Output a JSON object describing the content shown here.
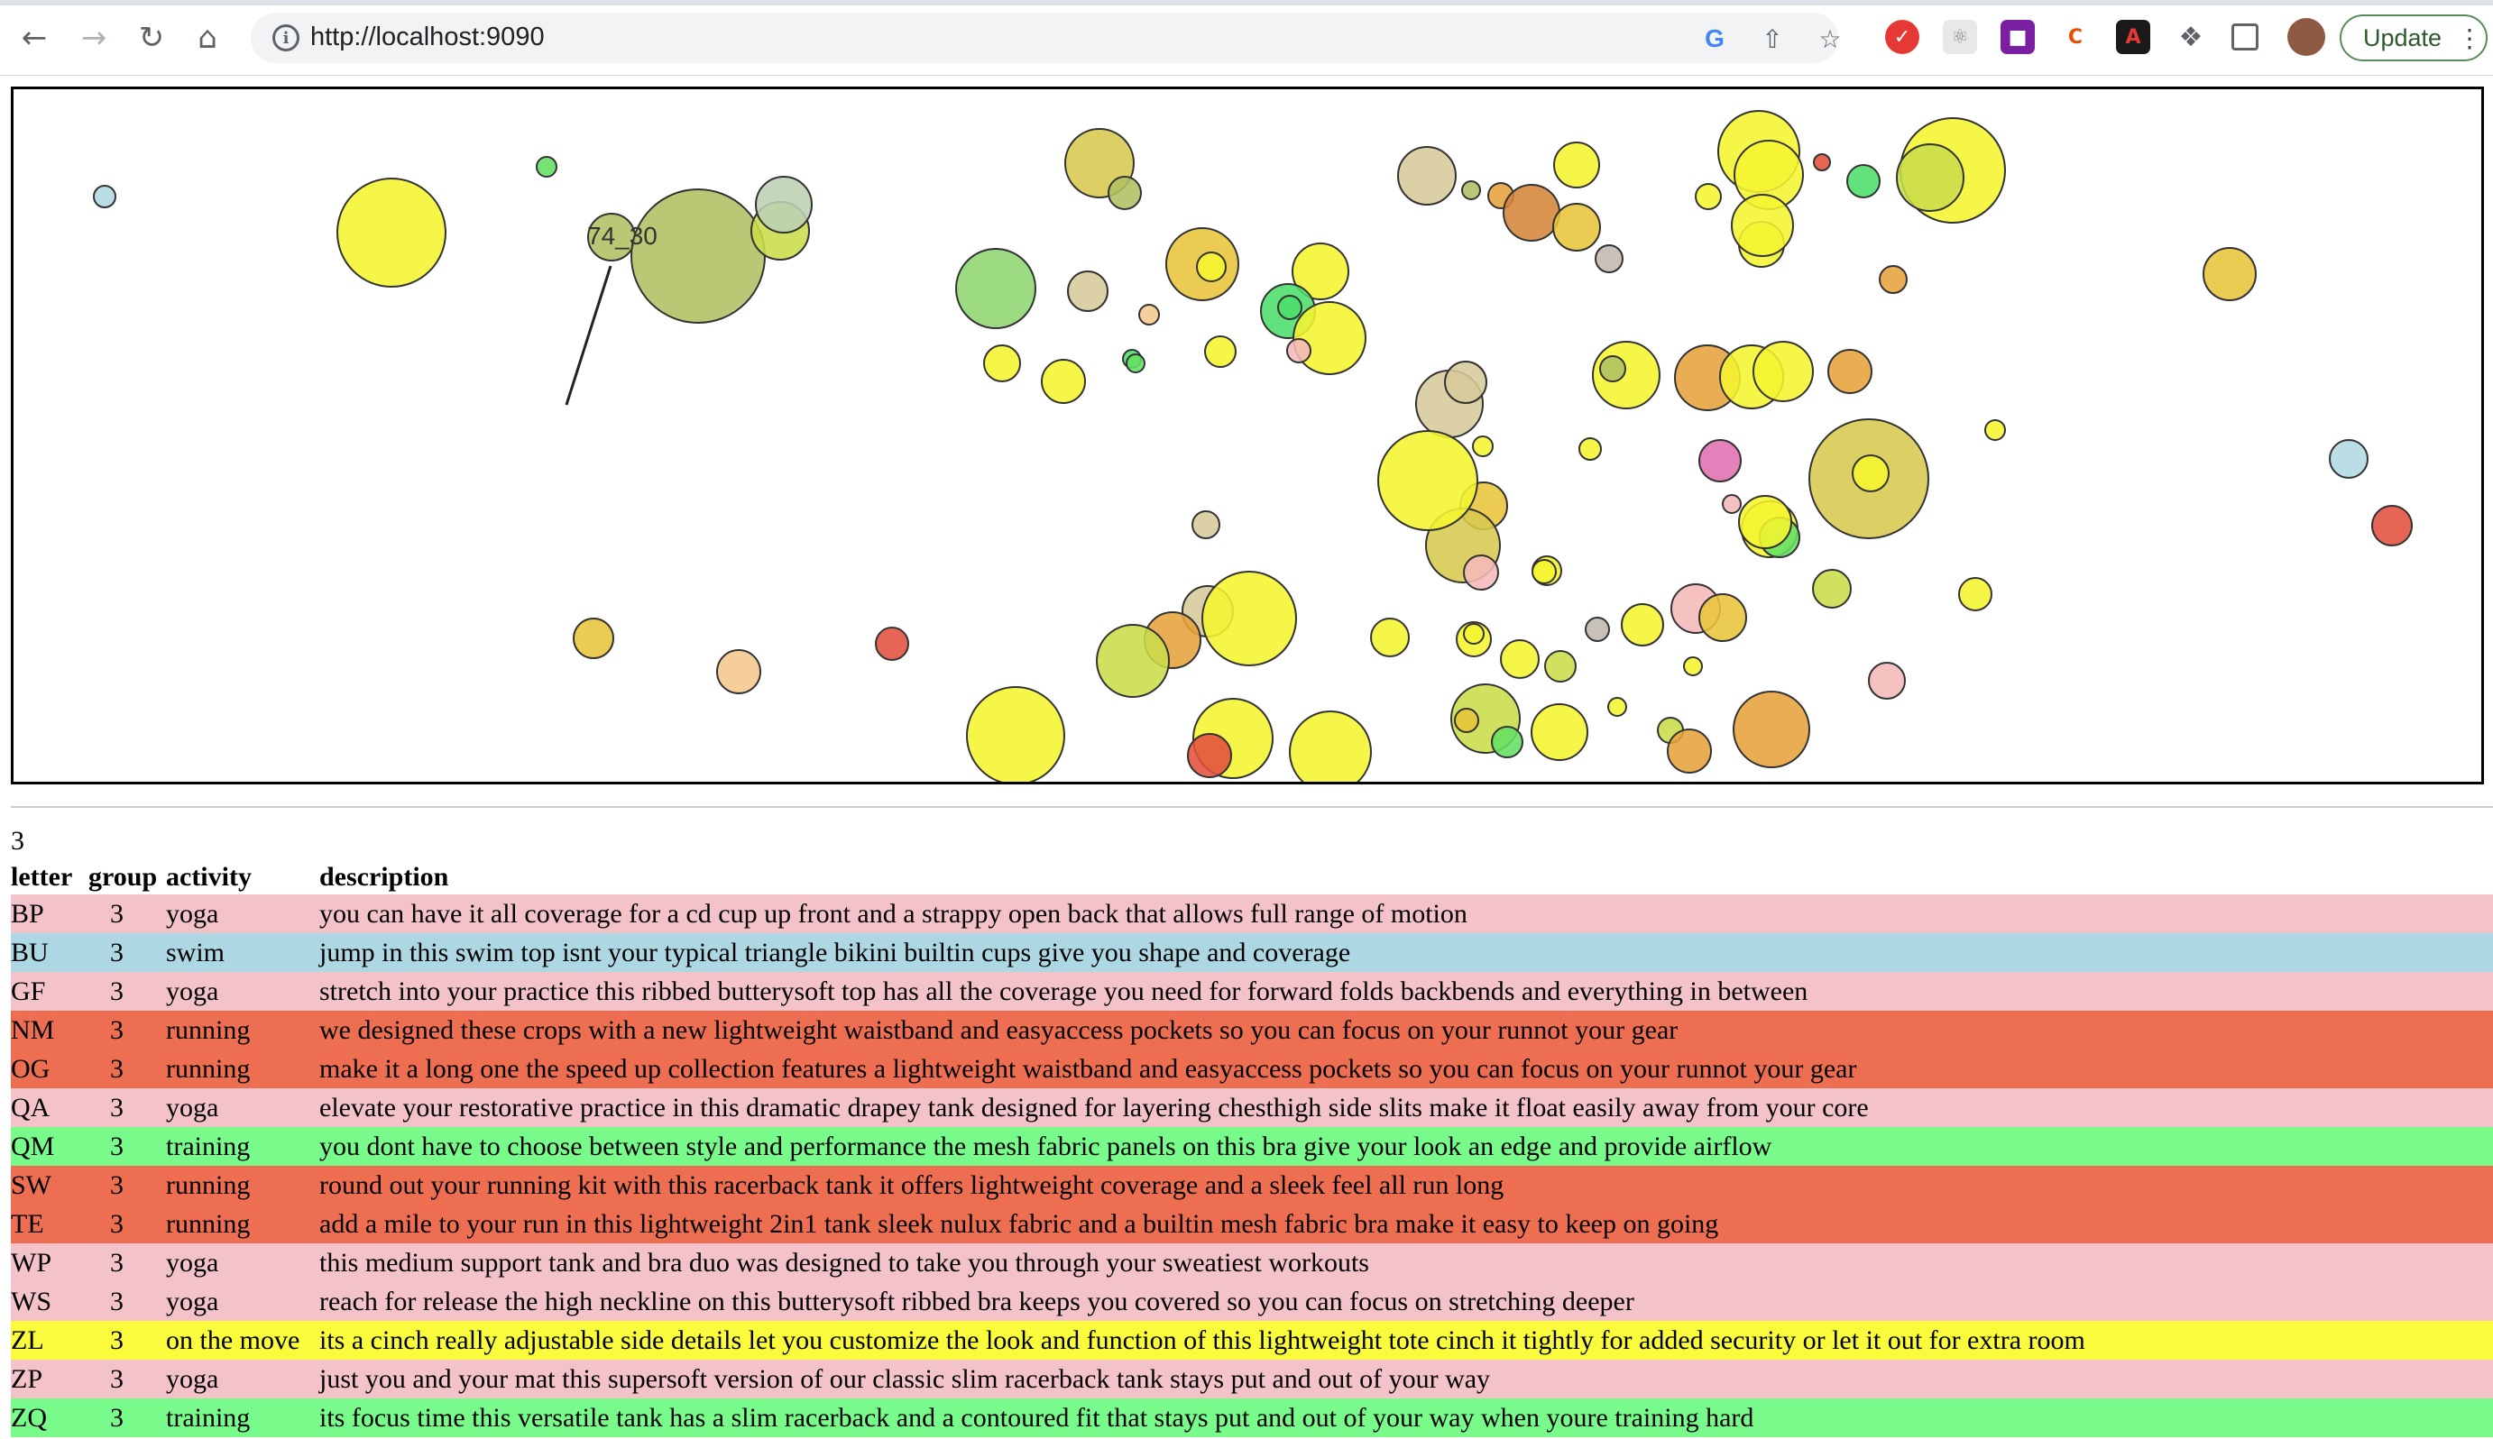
{
  "browser": {
    "url": "http://localhost:9090",
    "update_label": "Update"
  },
  "chart": {
    "annotation": "74_30",
    "colors": {
      "yellow": "#f5f530",
      "light_yellow": "#f0f23c",
      "yellow_green": "#c9dd4a",
      "olive": "#b0c063",
      "light_green": "#8ed670",
      "green": "#62e062",
      "bright_green": "#4cde6a",
      "gold": "#e8c43a",
      "mustard": "#d7c94e",
      "khaki": "#d7c99a",
      "orange": "#e6a23c",
      "dark_orange": "#d4853a",
      "peach": "#f5c78e",
      "pink": "#f5b8b8",
      "magenta": "#e070b0",
      "red": "#e3503c",
      "light_blue": "#b0d8e2",
      "sage": "#bcd0b2",
      "gray": "#c0b8b0"
    }
  },
  "table": {
    "group_heading": "3",
    "headers": {
      "letter": "letter",
      "group": "group",
      "activity": "activity",
      "description": "description"
    },
    "row_colors": {
      "yoga": "#f4c2c9",
      "swim": "#acd7e3",
      "running": "#ee6e52",
      "training": "#78fb8a",
      "on the move": "#f9fb3c"
    },
    "rows": [
      {
        "letter": "BP",
        "group": "3",
        "activity": "yoga",
        "description": "you can have it all coverage for a cd cup up front and a strappy open back that allows full range of motion"
      },
      {
        "letter": "BU",
        "group": "3",
        "activity": "swim",
        "description": "jump in this swim top isnt your typical triangle bikini builtin cups give you shape and coverage"
      },
      {
        "letter": "GF",
        "group": "3",
        "activity": "yoga",
        "description": "stretch into your practice this ribbed butterysoft top has all the coverage you need for forward folds backbends and everything in between"
      },
      {
        "letter": "NM",
        "group": "3",
        "activity": "running",
        "description": "we designed these crops with a new lightweight waistband and easyaccess pockets so you can focus on your runnot your gear"
      },
      {
        "letter": "OG",
        "group": "3",
        "activity": "running",
        "description": "make it a long one the speed up collection features a lightweight waistband and easyaccess pockets so you can focus on your runnot your gear"
      },
      {
        "letter": "QA",
        "group": "3",
        "activity": "yoga",
        "description": "elevate your restorative practice in this dramatic drapey tank designed for layering chesthigh side slits make it float easily away from your core"
      },
      {
        "letter": "QM",
        "group": "3",
        "activity": "training",
        "description": "you dont have to choose between style and performance the mesh fabric panels on this bra give your look an edge and provide airflow"
      },
      {
        "letter": "SW",
        "group": "3",
        "activity": "running",
        "description": "round out your running kit with this racerback tank it offers lightweight coverage and a sleek feel all run long"
      },
      {
        "letter": "TE",
        "group": "3",
        "activity": "running",
        "description": "add a mile to your run in this lightweight 2in1 tank sleek nulux fabric and a builtin mesh fabric bra make it easy to keep on going"
      },
      {
        "letter": "WP",
        "group": "3",
        "activity": "yoga",
        "description": "this medium support tank and bra duo was designed to take you through your sweatiest workouts"
      },
      {
        "letter": "WS",
        "group": "3",
        "activity": "yoga",
        "description": "reach for release the high neckline on this butterysoft ribbed bra keeps you covered so you can focus on stretching deeper"
      },
      {
        "letter": "ZL",
        "group": "3",
        "activity": "on the move",
        "description": "its a cinch really adjustable side details let you customize the look and function of this lightweight tote cinch it tightly for added security or let it out for extra room"
      },
      {
        "letter": "ZP",
        "group": "3",
        "activity": "yoga",
        "description": "just you and your mat this supersoft version of our classic slim racerback tank stays put and out of your way"
      },
      {
        "letter": "ZQ",
        "group": "3",
        "activity": "training",
        "description": "its focus time this versatile tank has a slim racerback and a contoured fit that stays put and out of your way when youre training hard"
      }
    ]
  }
}
